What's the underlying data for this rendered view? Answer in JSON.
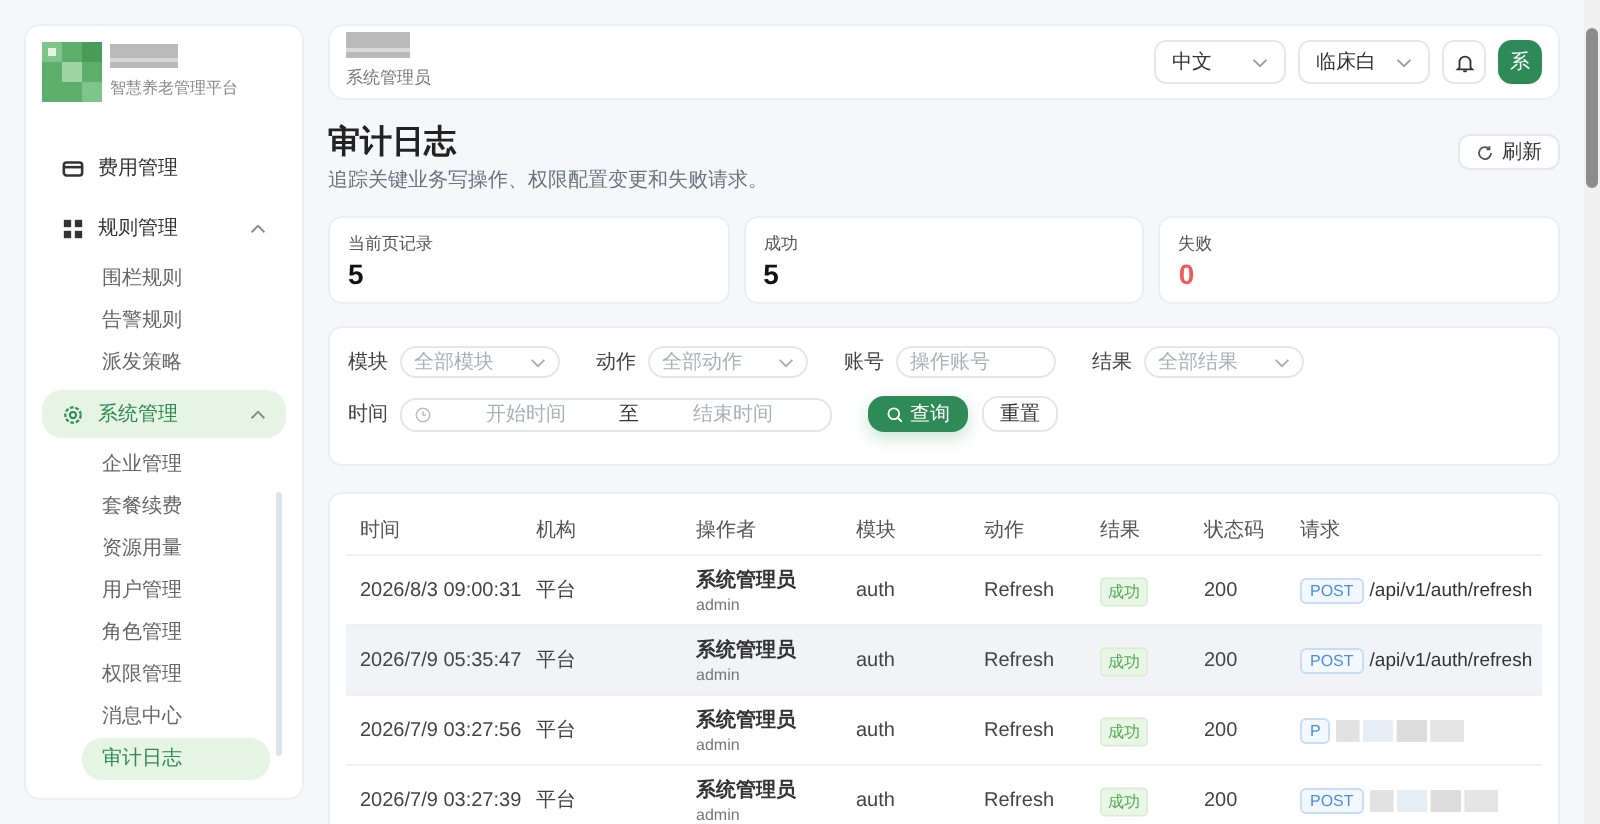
{
  "brand": {
    "subtitle": "智慧养老管理平台"
  },
  "nav": [
    {
      "label": "费用管理",
      "kind": "card",
      "selected": false
    },
    {
      "label": "规则管理",
      "kind": "grid",
      "selected": false,
      "expanded": true,
      "children": [
        {
          "label": "围栏规则",
          "selected": false
        },
        {
          "label": "告警规则",
          "selected": false
        },
        {
          "label": "派发策略",
          "selected": false
        }
      ]
    },
    {
      "label": "系统管理",
      "kind": "gear",
      "selected": true,
      "expanded": true,
      "children": [
        {
          "label": "企业管理",
          "selected": false
        },
        {
          "label": "套餐续费",
          "selected": false
        },
        {
          "label": "资源用量",
          "selected": false
        },
        {
          "label": "用户管理",
          "selected": false
        },
        {
          "label": "角色管理",
          "selected": false
        },
        {
          "label": "权限管理",
          "selected": false
        },
        {
          "label": "消息中心",
          "selected": false
        },
        {
          "label": "审计日志",
          "selected": true
        }
      ]
    }
  ],
  "header": {
    "role": "系统管理员",
    "language": "中文",
    "theme": "临床白",
    "avatar": "系"
  },
  "page": {
    "title": "审计日志",
    "subtitle": "追踪关键业务写操作、权限配置变更和失败请求。",
    "refresh": "刷新"
  },
  "stats": [
    {
      "label": "当前页记录",
      "value": "5",
      "color": "#111111"
    },
    {
      "label": "成功",
      "value": "5",
      "color": "#111111"
    },
    {
      "label": "失败",
      "value": "0",
      "color": "#f05a5a"
    }
  ],
  "filters": [
    {
      "label": "模块",
      "kind": "select",
      "placeholder": "全部模块"
    },
    {
      "label": "动作",
      "kind": "select",
      "placeholder": "全部动作"
    },
    {
      "label": "账号",
      "kind": "input",
      "placeholder": "操作账号"
    },
    {
      "label": "结果",
      "kind": "select",
      "placeholder": "全部结果"
    }
  ],
  "time_filter": {
    "label": "时间",
    "start_placeholder": "开始时间",
    "separator": "至",
    "end_placeholder": "结束时间"
  },
  "buttons": {
    "query": "查询",
    "reset": "重置"
  },
  "table": {
    "columns": [
      "时间",
      "机构",
      "操作者",
      "模块",
      "动作",
      "结果",
      "状态码",
      "请求"
    ],
    "rows": [
      {
        "time": "2026/8/3 09:00:31",
        "org": "平台",
        "operator": "系统管理员",
        "account": "admin",
        "module": "auth",
        "action": "Refresh",
        "result": "成功",
        "status": "200",
        "method": "POST",
        "path": "/api/v1/auth/refresh",
        "hovered": false
      },
      {
        "time": "2026/7/9 05:35:47",
        "org": "平台",
        "operator": "系统管理员",
        "account": "admin",
        "module": "auth",
        "action": "Refresh",
        "result": "成功",
        "status": "200",
        "method": "POST",
        "path": "/api/v1/auth/refresh",
        "hovered": true
      },
      {
        "time": "2026/7/9 03:27:56",
        "org": "平台",
        "operator": "系统管理员",
        "account": "admin",
        "module": "auth",
        "action": "Refresh",
        "result": "成功",
        "status": "200",
        "method": "P",
        "hovered": false
      },
      {
        "time": "2026/7/9 03:27:39",
        "org": "平台",
        "operator": "系统管理员",
        "account": "admin",
        "module": "auth",
        "action": "Refresh",
        "result": "成功",
        "status": "200",
        "method": "POST",
        "hovered": false
      }
    ]
  }
}
